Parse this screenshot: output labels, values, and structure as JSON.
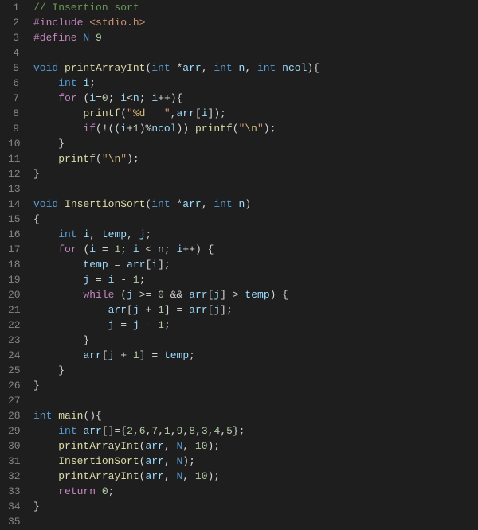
{
  "lineCount": 35,
  "code": {
    "l1": [
      {
        "cls": "comment",
        "t": "// Insertion sort"
      }
    ],
    "l2": [
      {
        "cls": "keyword",
        "t": "#include"
      },
      {
        "cls": "",
        "t": " "
      },
      {
        "cls": "string",
        "t": "<stdio.h>"
      }
    ],
    "l3": [
      {
        "cls": "keyword",
        "t": "#define"
      },
      {
        "cls": "",
        "t": " "
      },
      {
        "cls": "macro",
        "t": "N"
      },
      {
        "cls": "",
        "t": " "
      },
      {
        "cls": "number",
        "t": "9"
      }
    ],
    "l4": [],
    "l5": [
      {
        "cls": "type",
        "t": "void"
      },
      {
        "cls": "",
        "t": " "
      },
      {
        "cls": "func",
        "t": "printArrayInt"
      },
      {
        "cls": "punct",
        "t": "("
      },
      {
        "cls": "type",
        "t": "int"
      },
      {
        "cls": "",
        "t": " "
      },
      {
        "cls": "op",
        "t": "*"
      },
      {
        "cls": "var",
        "t": "arr"
      },
      {
        "cls": "punct",
        "t": ", "
      },
      {
        "cls": "type",
        "t": "int"
      },
      {
        "cls": "",
        "t": " "
      },
      {
        "cls": "var",
        "t": "n"
      },
      {
        "cls": "punct",
        "t": ", "
      },
      {
        "cls": "type",
        "t": "int"
      },
      {
        "cls": "",
        "t": " "
      },
      {
        "cls": "var",
        "t": "ncol"
      },
      {
        "cls": "punct",
        "t": "){"
      }
    ],
    "l6": [
      {
        "cls": "",
        "t": "    "
      },
      {
        "cls": "type",
        "t": "int"
      },
      {
        "cls": "",
        "t": " "
      },
      {
        "cls": "var",
        "t": "i"
      },
      {
        "cls": "punct",
        "t": ";"
      }
    ],
    "l7": [
      {
        "cls": "",
        "t": "    "
      },
      {
        "cls": "keyword",
        "t": "for"
      },
      {
        "cls": "",
        "t": " "
      },
      {
        "cls": "punct",
        "t": "("
      },
      {
        "cls": "var",
        "t": "i"
      },
      {
        "cls": "op",
        "t": "="
      },
      {
        "cls": "number",
        "t": "0"
      },
      {
        "cls": "punct",
        "t": "; "
      },
      {
        "cls": "var",
        "t": "i"
      },
      {
        "cls": "op",
        "t": "<"
      },
      {
        "cls": "var",
        "t": "n"
      },
      {
        "cls": "punct",
        "t": "; "
      },
      {
        "cls": "var",
        "t": "i"
      },
      {
        "cls": "op",
        "t": "++"
      },
      {
        "cls": "punct",
        "t": "){"
      }
    ],
    "l8": [
      {
        "cls": "",
        "t": "        "
      },
      {
        "cls": "func",
        "t": "printf"
      },
      {
        "cls": "punct",
        "t": "("
      },
      {
        "cls": "string",
        "t": "\""
      },
      {
        "cls": "esc",
        "t": "%d"
      },
      {
        "cls": "string",
        "t": "   \""
      },
      {
        "cls": "punct",
        "t": ","
      },
      {
        "cls": "var",
        "t": "arr"
      },
      {
        "cls": "punct",
        "t": "["
      },
      {
        "cls": "var",
        "t": "i"
      },
      {
        "cls": "punct",
        "t": "]);"
      }
    ],
    "l9": [
      {
        "cls": "",
        "t": "        "
      },
      {
        "cls": "keyword",
        "t": "if"
      },
      {
        "cls": "punct",
        "t": "(!(("
      },
      {
        "cls": "var",
        "t": "i"
      },
      {
        "cls": "op",
        "t": "+"
      },
      {
        "cls": "number",
        "t": "1"
      },
      {
        "cls": "punct",
        "t": ")"
      },
      {
        "cls": "op",
        "t": "%"
      },
      {
        "cls": "var",
        "t": "ncol"
      },
      {
        "cls": "punct",
        "t": ")) "
      },
      {
        "cls": "func",
        "t": "printf"
      },
      {
        "cls": "punct",
        "t": "("
      },
      {
        "cls": "string",
        "t": "\""
      },
      {
        "cls": "esc",
        "t": "\\n"
      },
      {
        "cls": "string",
        "t": "\""
      },
      {
        "cls": "punct",
        "t": ");"
      }
    ],
    "l10": [
      {
        "cls": "",
        "t": "    "
      },
      {
        "cls": "punct",
        "t": "}"
      }
    ],
    "l11": [
      {
        "cls": "",
        "t": "    "
      },
      {
        "cls": "func",
        "t": "printf"
      },
      {
        "cls": "punct",
        "t": "("
      },
      {
        "cls": "string",
        "t": "\""
      },
      {
        "cls": "esc",
        "t": "\\n"
      },
      {
        "cls": "string",
        "t": "\""
      },
      {
        "cls": "punct",
        "t": ");"
      }
    ],
    "l12": [
      {
        "cls": "punct",
        "t": "}"
      }
    ],
    "l13": [],
    "l14": [
      {
        "cls": "type",
        "t": "void"
      },
      {
        "cls": "",
        "t": " "
      },
      {
        "cls": "func",
        "t": "InsertionSort"
      },
      {
        "cls": "punct",
        "t": "("
      },
      {
        "cls": "type",
        "t": "int"
      },
      {
        "cls": "",
        "t": " "
      },
      {
        "cls": "op",
        "t": "*"
      },
      {
        "cls": "var",
        "t": "arr"
      },
      {
        "cls": "punct",
        "t": ", "
      },
      {
        "cls": "type",
        "t": "int"
      },
      {
        "cls": "",
        "t": " "
      },
      {
        "cls": "var",
        "t": "n"
      },
      {
        "cls": "punct",
        "t": ")"
      }
    ],
    "l15": [
      {
        "cls": "punct",
        "t": "{"
      }
    ],
    "l16": [
      {
        "cls": "",
        "t": "    "
      },
      {
        "cls": "type",
        "t": "int"
      },
      {
        "cls": "",
        "t": " "
      },
      {
        "cls": "var",
        "t": "i"
      },
      {
        "cls": "punct",
        "t": ", "
      },
      {
        "cls": "var",
        "t": "temp"
      },
      {
        "cls": "punct",
        "t": ", "
      },
      {
        "cls": "var",
        "t": "j"
      },
      {
        "cls": "punct",
        "t": ";"
      }
    ],
    "l17": [
      {
        "cls": "",
        "t": "    "
      },
      {
        "cls": "keyword",
        "t": "for"
      },
      {
        "cls": "",
        "t": " "
      },
      {
        "cls": "punct",
        "t": "("
      },
      {
        "cls": "var",
        "t": "i"
      },
      {
        "cls": "",
        "t": " "
      },
      {
        "cls": "op",
        "t": "="
      },
      {
        "cls": "",
        "t": " "
      },
      {
        "cls": "number",
        "t": "1"
      },
      {
        "cls": "punct",
        "t": "; "
      },
      {
        "cls": "var",
        "t": "i"
      },
      {
        "cls": "",
        "t": " "
      },
      {
        "cls": "op",
        "t": "<"
      },
      {
        "cls": "",
        "t": " "
      },
      {
        "cls": "var",
        "t": "n"
      },
      {
        "cls": "punct",
        "t": "; "
      },
      {
        "cls": "var",
        "t": "i"
      },
      {
        "cls": "op",
        "t": "++"
      },
      {
        "cls": "punct",
        "t": ") {"
      }
    ],
    "l18": [
      {
        "cls": "",
        "t": "        "
      },
      {
        "cls": "var",
        "t": "temp"
      },
      {
        "cls": "",
        "t": " "
      },
      {
        "cls": "op",
        "t": "="
      },
      {
        "cls": "",
        "t": " "
      },
      {
        "cls": "var",
        "t": "arr"
      },
      {
        "cls": "punct",
        "t": "["
      },
      {
        "cls": "var",
        "t": "i"
      },
      {
        "cls": "punct",
        "t": "];"
      }
    ],
    "l19": [
      {
        "cls": "",
        "t": "        "
      },
      {
        "cls": "var",
        "t": "j"
      },
      {
        "cls": "",
        "t": " "
      },
      {
        "cls": "op",
        "t": "="
      },
      {
        "cls": "",
        "t": " "
      },
      {
        "cls": "var",
        "t": "i"
      },
      {
        "cls": "",
        "t": " "
      },
      {
        "cls": "op",
        "t": "-"
      },
      {
        "cls": "",
        "t": " "
      },
      {
        "cls": "number",
        "t": "1"
      },
      {
        "cls": "punct",
        "t": ";"
      }
    ],
    "l20": [
      {
        "cls": "",
        "t": "        "
      },
      {
        "cls": "keyword",
        "t": "while"
      },
      {
        "cls": "",
        "t": " "
      },
      {
        "cls": "punct",
        "t": "("
      },
      {
        "cls": "var",
        "t": "j"
      },
      {
        "cls": "",
        "t": " "
      },
      {
        "cls": "op",
        "t": ">="
      },
      {
        "cls": "",
        "t": " "
      },
      {
        "cls": "number",
        "t": "0"
      },
      {
        "cls": "",
        "t": " "
      },
      {
        "cls": "op",
        "t": "&&"
      },
      {
        "cls": "",
        "t": " "
      },
      {
        "cls": "var",
        "t": "arr"
      },
      {
        "cls": "punct",
        "t": "["
      },
      {
        "cls": "var",
        "t": "j"
      },
      {
        "cls": "punct",
        "t": "] "
      },
      {
        "cls": "op",
        "t": ">"
      },
      {
        "cls": "",
        "t": " "
      },
      {
        "cls": "var",
        "t": "temp"
      },
      {
        "cls": "punct",
        "t": ") {"
      }
    ],
    "l21": [
      {
        "cls": "",
        "t": "            "
      },
      {
        "cls": "var",
        "t": "arr"
      },
      {
        "cls": "punct",
        "t": "["
      },
      {
        "cls": "var",
        "t": "j"
      },
      {
        "cls": "",
        "t": " "
      },
      {
        "cls": "op",
        "t": "+"
      },
      {
        "cls": "",
        "t": " "
      },
      {
        "cls": "number",
        "t": "1"
      },
      {
        "cls": "punct",
        "t": "] "
      },
      {
        "cls": "op",
        "t": "="
      },
      {
        "cls": "",
        "t": " "
      },
      {
        "cls": "var",
        "t": "arr"
      },
      {
        "cls": "punct",
        "t": "["
      },
      {
        "cls": "var",
        "t": "j"
      },
      {
        "cls": "punct",
        "t": "];"
      }
    ],
    "l22": [
      {
        "cls": "",
        "t": "            "
      },
      {
        "cls": "var",
        "t": "j"
      },
      {
        "cls": "",
        "t": " "
      },
      {
        "cls": "op",
        "t": "="
      },
      {
        "cls": "",
        "t": " "
      },
      {
        "cls": "var",
        "t": "j"
      },
      {
        "cls": "",
        "t": " "
      },
      {
        "cls": "op",
        "t": "-"
      },
      {
        "cls": "",
        "t": " "
      },
      {
        "cls": "number",
        "t": "1"
      },
      {
        "cls": "punct",
        "t": ";"
      }
    ],
    "l23": [
      {
        "cls": "",
        "t": "        "
      },
      {
        "cls": "punct",
        "t": "}"
      }
    ],
    "l24": [
      {
        "cls": "",
        "t": "        "
      },
      {
        "cls": "var",
        "t": "arr"
      },
      {
        "cls": "punct",
        "t": "["
      },
      {
        "cls": "var",
        "t": "j"
      },
      {
        "cls": "",
        "t": " "
      },
      {
        "cls": "op",
        "t": "+"
      },
      {
        "cls": "",
        "t": " "
      },
      {
        "cls": "number",
        "t": "1"
      },
      {
        "cls": "punct",
        "t": "] "
      },
      {
        "cls": "op",
        "t": "="
      },
      {
        "cls": "",
        "t": " "
      },
      {
        "cls": "var",
        "t": "temp"
      },
      {
        "cls": "punct",
        "t": ";"
      }
    ],
    "l25": [
      {
        "cls": "",
        "t": "    "
      },
      {
        "cls": "punct",
        "t": "}"
      }
    ],
    "l26": [
      {
        "cls": "punct",
        "t": "}"
      }
    ],
    "l27": [],
    "l28": [
      {
        "cls": "type",
        "t": "int"
      },
      {
        "cls": "",
        "t": " "
      },
      {
        "cls": "func",
        "t": "main"
      },
      {
        "cls": "punct",
        "t": "(){"
      }
    ],
    "l29": [
      {
        "cls": "",
        "t": "    "
      },
      {
        "cls": "type",
        "t": "int"
      },
      {
        "cls": "",
        "t": " "
      },
      {
        "cls": "var",
        "t": "arr"
      },
      {
        "cls": "punct",
        "t": "[]={"
      },
      {
        "cls": "number",
        "t": "2"
      },
      {
        "cls": "punct",
        "t": ","
      },
      {
        "cls": "number",
        "t": "6"
      },
      {
        "cls": "punct",
        "t": ","
      },
      {
        "cls": "number",
        "t": "7"
      },
      {
        "cls": "punct",
        "t": ","
      },
      {
        "cls": "number",
        "t": "1"
      },
      {
        "cls": "punct",
        "t": ","
      },
      {
        "cls": "number",
        "t": "9"
      },
      {
        "cls": "punct",
        "t": ","
      },
      {
        "cls": "number",
        "t": "8"
      },
      {
        "cls": "punct",
        "t": ","
      },
      {
        "cls": "number",
        "t": "3"
      },
      {
        "cls": "punct",
        "t": ","
      },
      {
        "cls": "number",
        "t": "4"
      },
      {
        "cls": "punct",
        "t": ","
      },
      {
        "cls": "number",
        "t": "5"
      },
      {
        "cls": "punct",
        "t": "};"
      }
    ],
    "l30": [
      {
        "cls": "",
        "t": "    "
      },
      {
        "cls": "func",
        "t": "printArrayInt"
      },
      {
        "cls": "punct",
        "t": "("
      },
      {
        "cls": "var",
        "t": "arr"
      },
      {
        "cls": "punct",
        "t": ", "
      },
      {
        "cls": "macro",
        "t": "N"
      },
      {
        "cls": "punct",
        "t": ", "
      },
      {
        "cls": "number",
        "t": "10"
      },
      {
        "cls": "punct",
        "t": ");"
      }
    ],
    "l31": [
      {
        "cls": "",
        "t": "    "
      },
      {
        "cls": "func",
        "t": "InsertionSort"
      },
      {
        "cls": "punct",
        "t": "("
      },
      {
        "cls": "var",
        "t": "arr"
      },
      {
        "cls": "punct",
        "t": ", "
      },
      {
        "cls": "macro",
        "t": "N"
      },
      {
        "cls": "punct",
        "t": ");"
      }
    ],
    "l32": [
      {
        "cls": "",
        "t": "    "
      },
      {
        "cls": "func",
        "t": "printArrayInt"
      },
      {
        "cls": "punct",
        "t": "("
      },
      {
        "cls": "var",
        "t": "arr"
      },
      {
        "cls": "punct",
        "t": ", "
      },
      {
        "cls": "macro",
        "t": "N"
      },
      {
        "cls": "punct",
        "t": ", "
      },
      {
        "cls": "number",
        "t": "10"
      },
      {
        "cls": "punct",
        "t": ");"
      }
    ],
    "l33": [
      {
        "cls": "",
        "t": "    "
      },
      {
        "cls": "keyword",
        "t": "return"
      },
      {
        "cls": "",
        "t": " "
      },
      {
        "cls": "number",
        "t": "0"
      },
      {
        "cls": "punct",
        "t": ";"
      }
    ],
    "l34": [
      {
        "cls": "punct",
        "t": "}"
      }
    ],
    "l35": []
  }
}
